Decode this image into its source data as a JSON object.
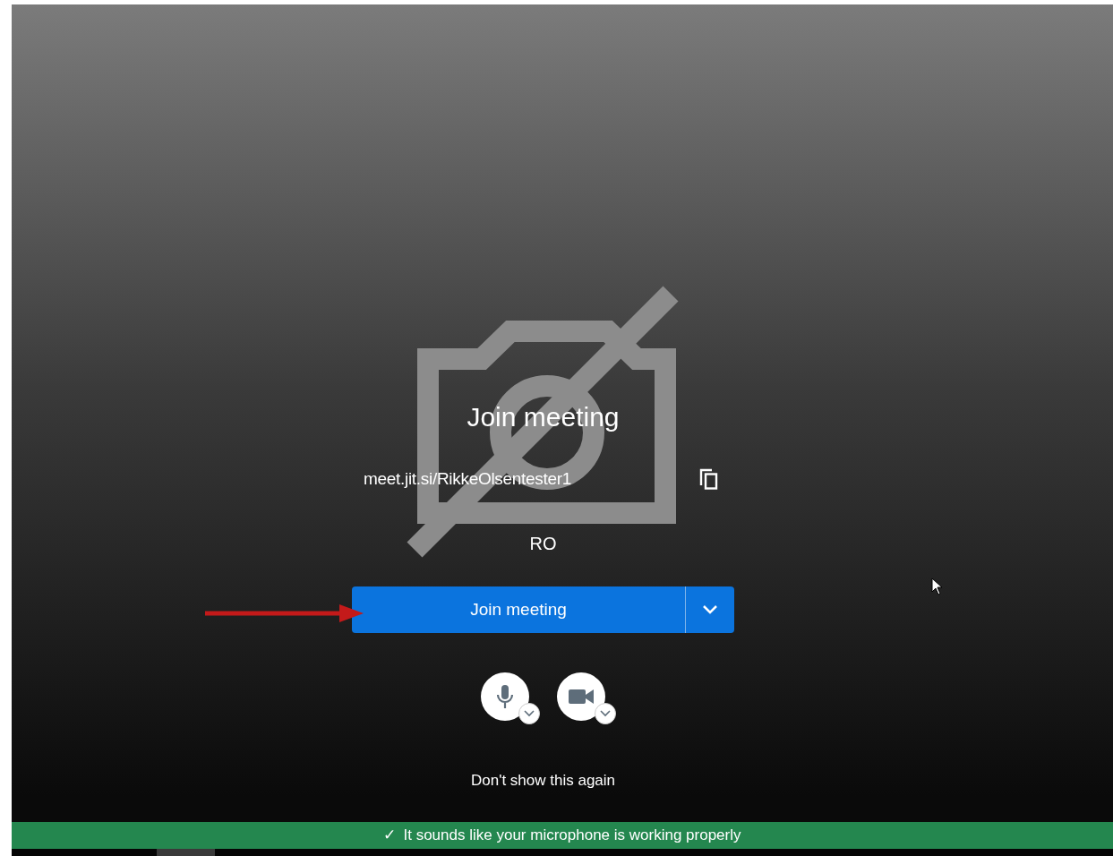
{
  "prejoin": {
    "title": "Join meeting",
    "room_url": "meet.jit.si/RikkeOlsentester1",
    "display_name": "RO",
    "join_button": {
      "label": "Join meeting"
    },
    "dont_show_again": "Don't show this again"
  },
  "notification": {
    "icon": "✓",
    "text": "It sounds like your microphone is working properly"
  }
}
